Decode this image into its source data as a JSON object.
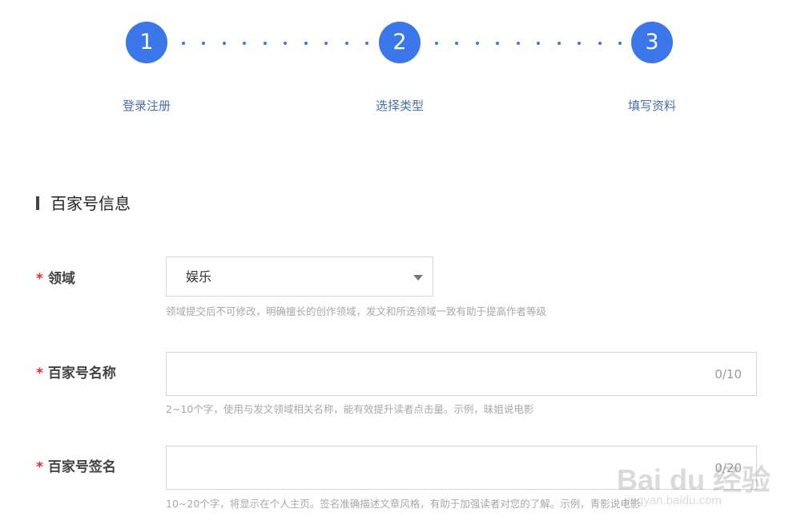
{
  "stepper": {
    "steps": [
      {
        "number": "1",
        "label": "登录注册"
      },
      {
        "number": "2",
        "label": "选择类型"
      },
      {
        "number": "3",
        "label": "填写资料"
      }
    ],
    "accent_color": "#3b76ea",
    "label_color": "#4a6ea8"
  },
  "section": {
    "title": "百家号信息"
  },
  "form": {
    "required_mark": "*",
    "domain": {
      "label": "领域",
      "selected_value": "娱乐",
      "hint": "领域提交后不可修改，明确擅长的创作领域，发文和所选领域一致有助于提高作者等级"
    },
    "name": {
      "label": "百家号名称",
      "value": "",
      "counter": "0/10",
      "hint": "2~10个字，使用与发文领域相关名称，能有效提升读者点击量。示例，昧姐说电影"
    },
    "signature": {
      "label": "百家号签名",
      "value": "",
      "counter": "0/20",
      "hint": "10~20个字，将显示在个人主页。签名准确描述文章风格，有助于加强读者对您的了解。示例，青影说电影"
    }
  },
  "watermark": {
    "brand": "Bai du 经验",
    "url": "jingyan.baidu.com"
  },
  "colors": {
    "required": "#d9302c",
    "hint": "#a8a8a8"
  }
}
